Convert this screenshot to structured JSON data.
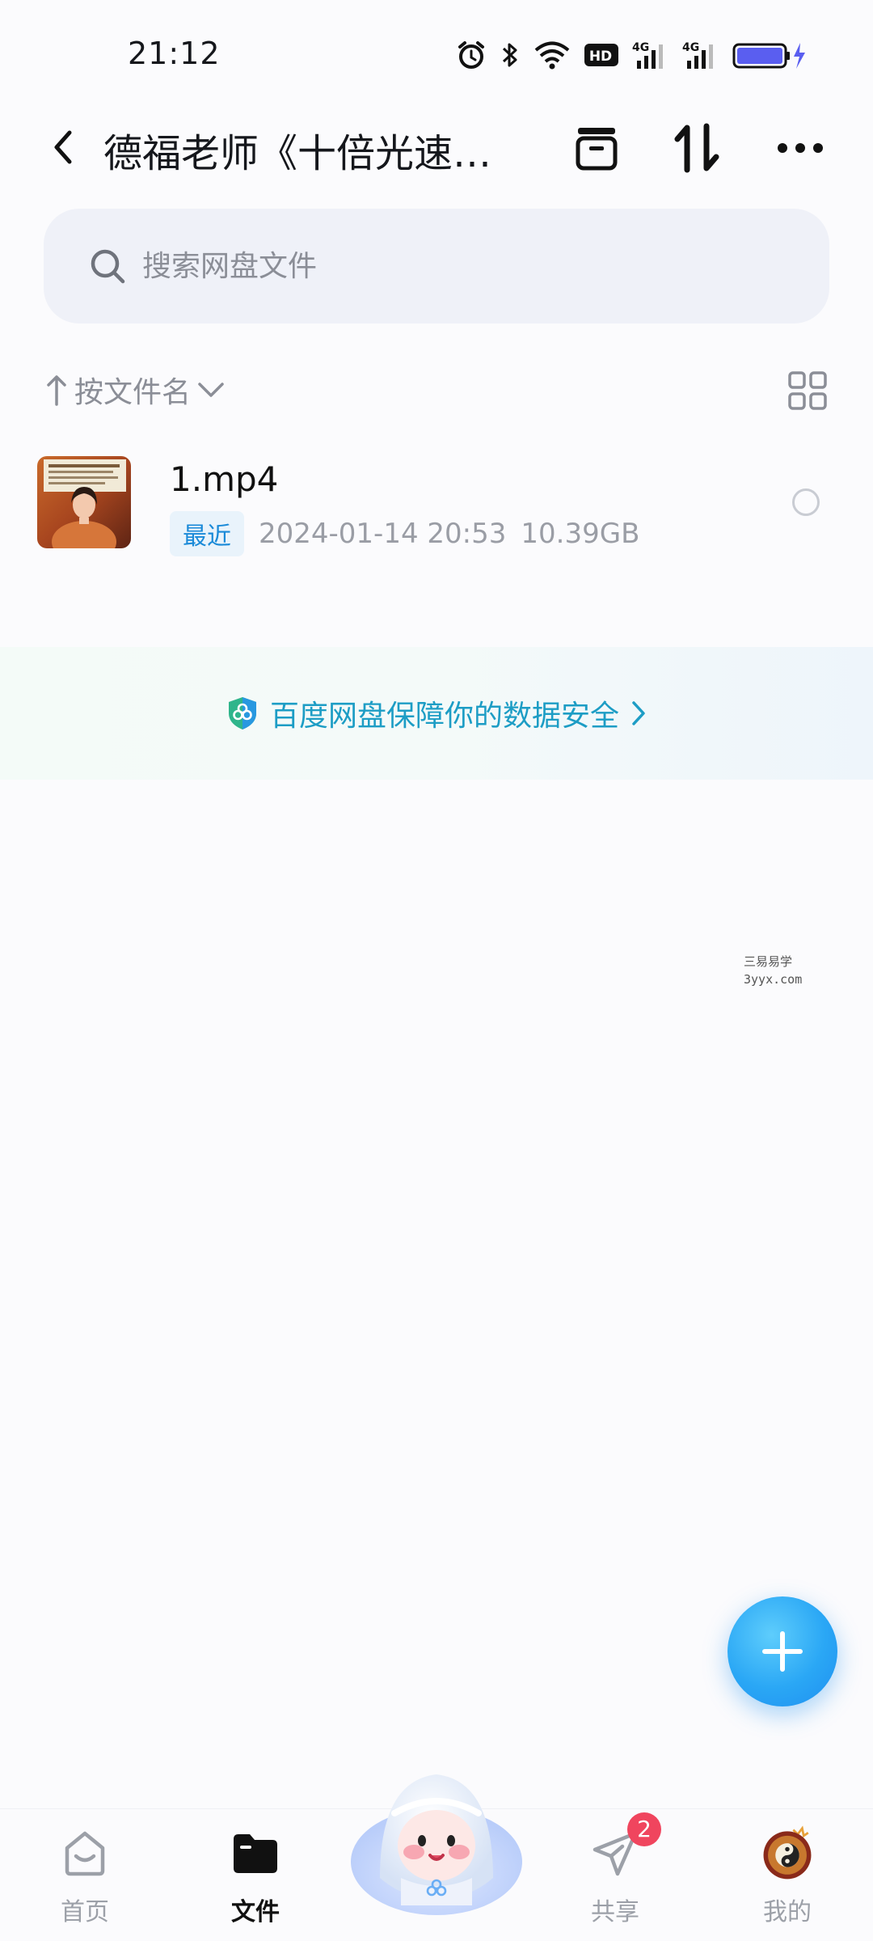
{
  "status_bar": {
    "time": "21:12",
    "icons": [
      "alarm-icon",
      "bluetooth-icon",
      "wifi-icon",
      "hd-icon",
      "signal-4g-icon",
      "signal-4g-icon",
      "battery-charging-icon"
    ],
    "hd_label": "HD",
    "network_label": "4G"
  },
  "header": {
    "title": "德福老师《十倍光速…",
    "icons": [
      "chevron-left-icon",
      "archive-icon",
      "sort-transfer-icon",
      "more-icon"
    ]
  },
  "search": {
    "placeholder": "搜索网盘文件"
  },
  "sort": {
    "label": "按文件名"
  },
  "files": [
    {
      "name": "1.mp4",
      "badge": "最近",
      "date": "2024-01-14  20:53",
      "size": "10.39GB"
    }
  ],
  "security_banner": {
    "text": "百度网盘保障你的数据安全"
  },
  "watermark": {
    "line1": "三易易学",
    "line2": "3yyx.com"
  },
  "bottom_nav": {
    "items": [
      {
        "label": "首页",
        "icon": "home-icon"
      },
      {
        "label": "文件",
        "icon": "folder-icon"
      },
      {
        "label": "共享",
        "icon": "send-icon",
        "badge": "2"
      },
      {
        "label": "我的",
        "icon": "avatar-icon"
      }
    ]
  },
  "colors": {
    "accent": "#1a8ad8",
    "fab": "#2aa7f5",
    "badge": "#f0455e",
    "banner_text": "#1d9dc5"
  }
}
